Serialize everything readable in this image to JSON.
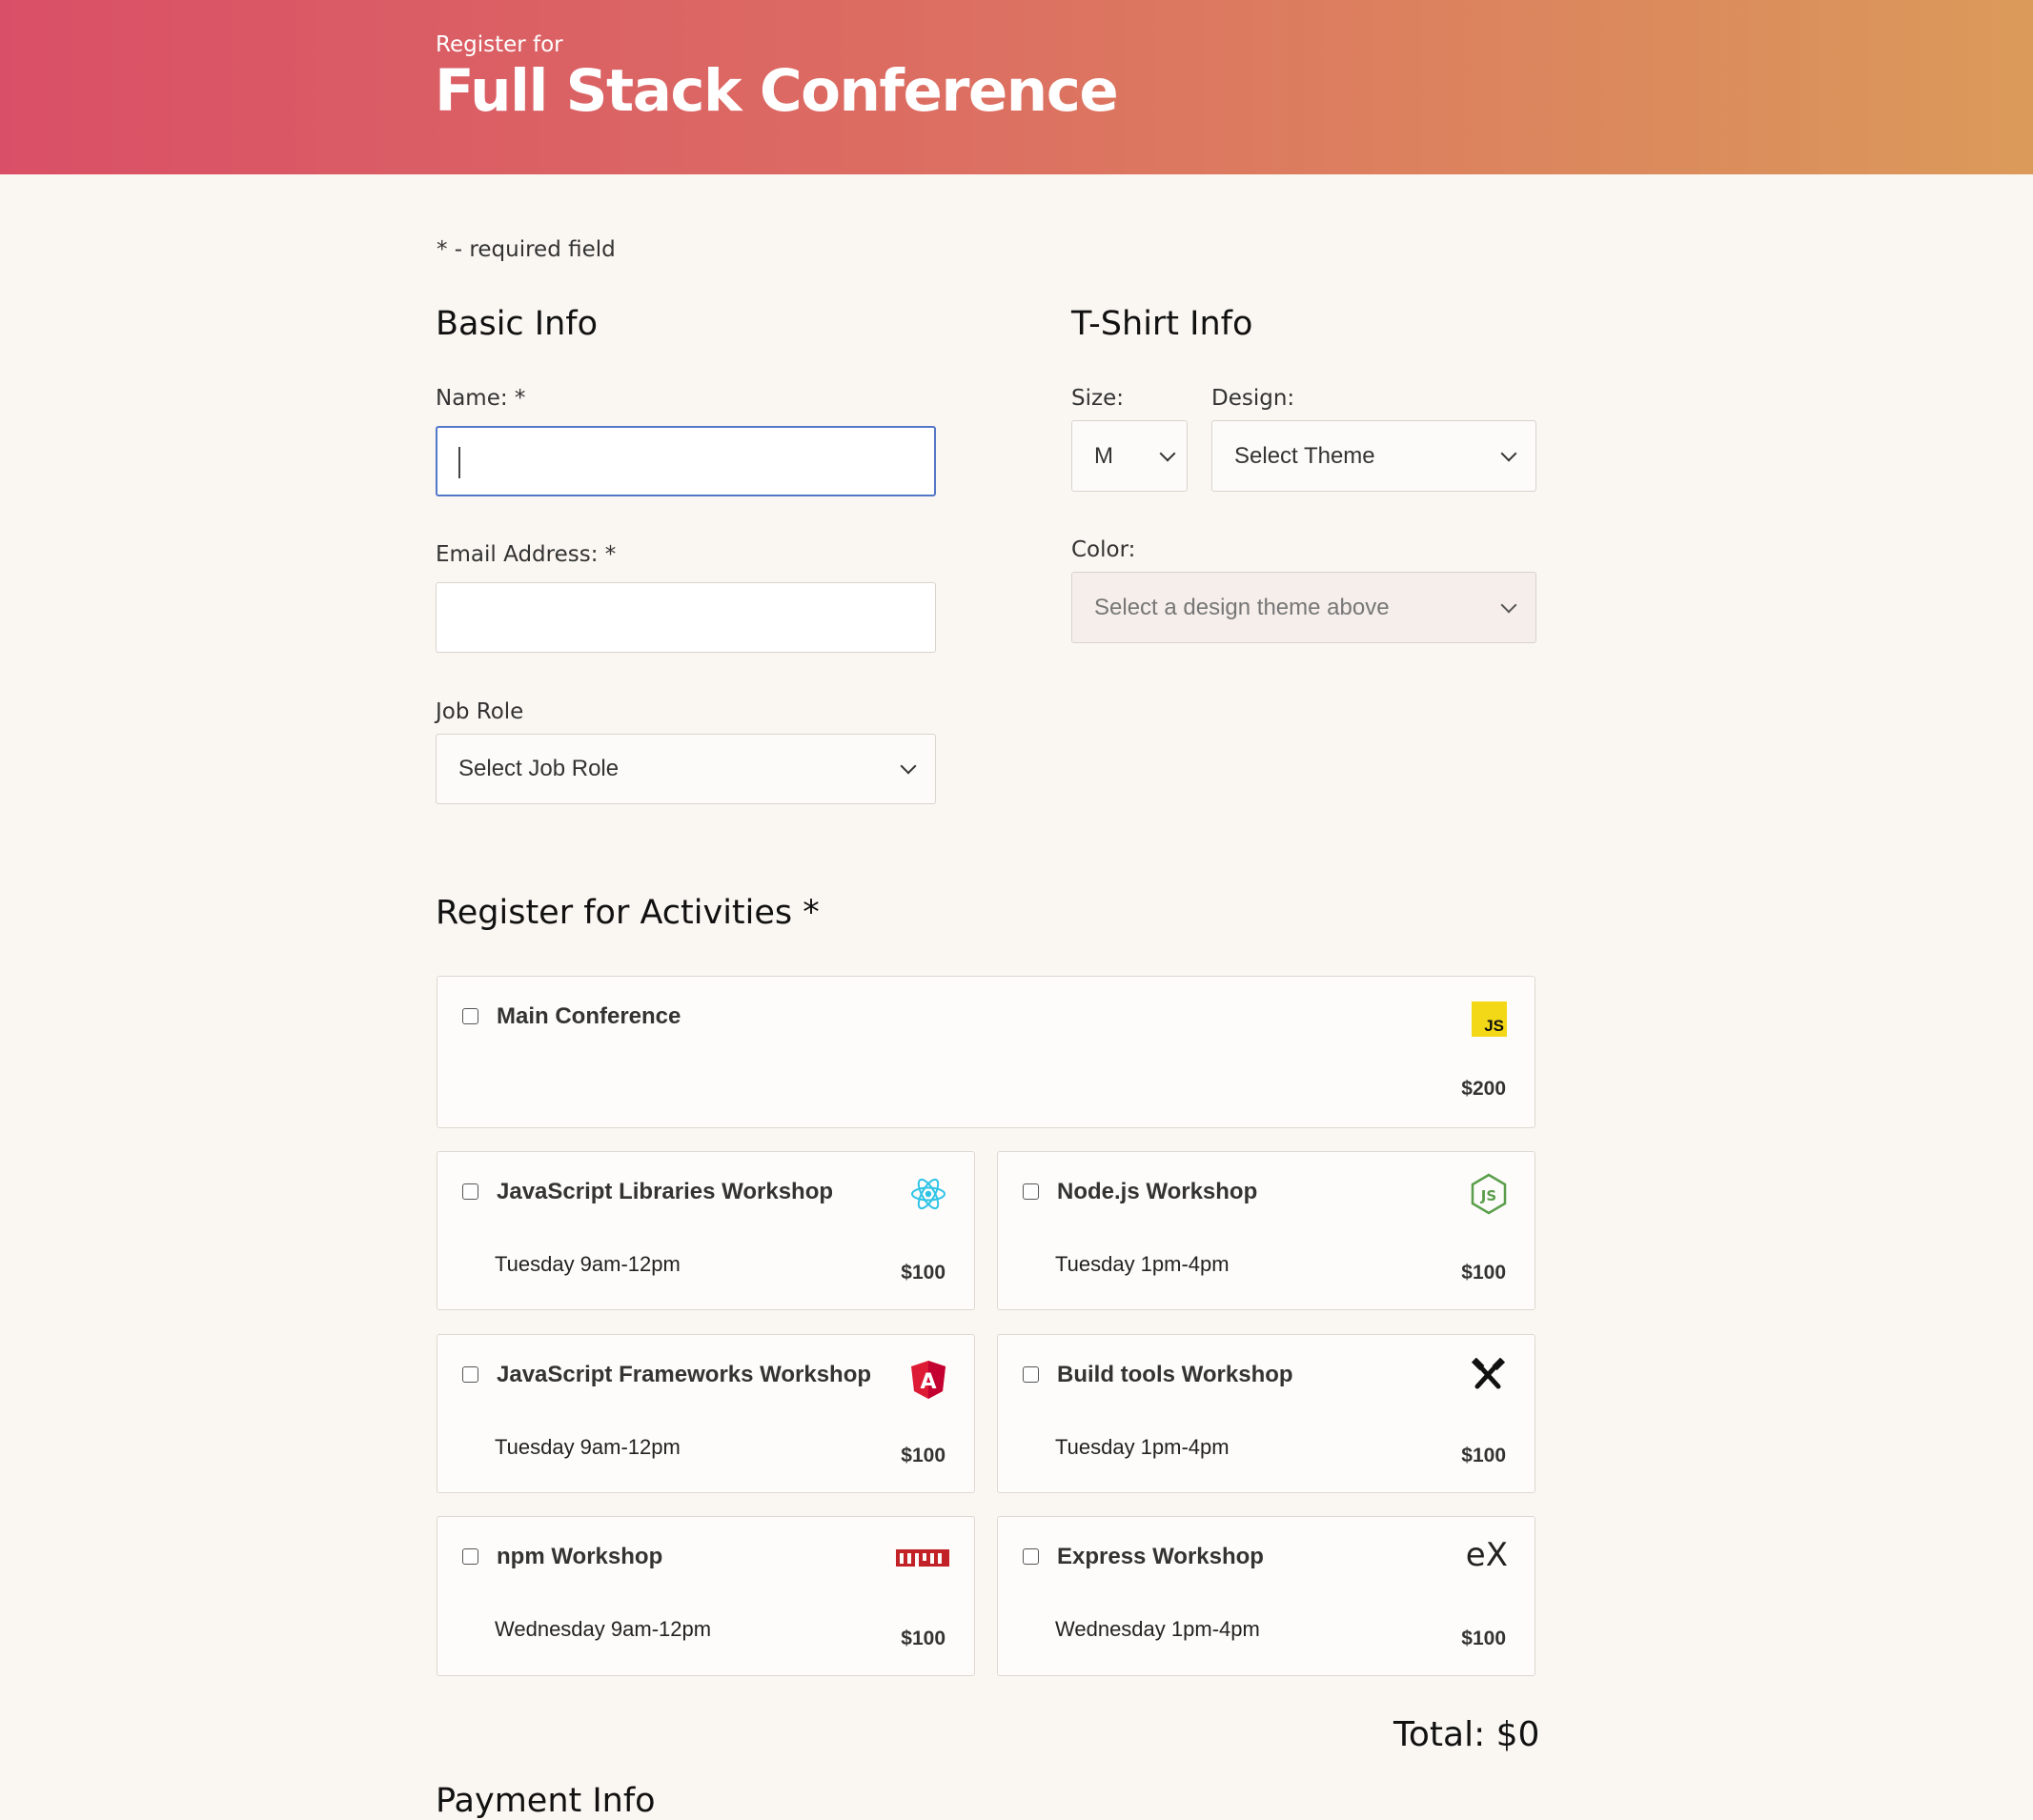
{
  "header": {
    "kicker": "Register for",
    "title": "Full Stack Conference"
  },
  "required_note": "* - required field",
  "basic_info": {
    "title": "Basic Info",
    "name_label": "Name: *",
    "name_value": "",
    "email_label": "Email Address: *",
    "email_value": "",
    "job_role_label": "Job Role",
    "job_role_selected": "Select Job Role"
  },
  "tshirt_info": {
    "title": "T-Shirt Info",
    "size_label": "Size:",
    "size_selected": "M",
    "design_label": "Design:",
    "design_selected": "Select Theme",
    "color_label": "Color:",
    "color_selected": "Select a design theme above"
  },
  "activities": {
    "title": "Register for Activities *",
    "items": [
      {
        "name": "Main Conference",
        "time": "",
        "price": "$200",
        "icon": "js-icon",
        "checked": false
      },
      {
        "name": "JavaScript Libraries Workshop",
        "time": "Tuesday 9am-12pm",
        "price": "$100",
        "icon": "react-icon",
        "checked": false
      },
      {
        "name": "Node.js Workshop",
        "time": "Tuesday 1pm-4pm",
        "price": "$100",
        "icon": "nodejs-icon",
        "checked": false
      },
      {
        "name": "JavaScript Frameworks Workshop",
        "time": "Tuesday 9am-12pm",
        "price": "$100",
        "icon": "angular-icon",
        "checked": false
      },
      {
        "name": "Build tools Workshop",
        "time": "Tuesday 1pm-4pm",
        "price": "$100",
        "icon": "tools-icon",
        "checked": false
      },
      {
        "name": "npm Workshop",
        "time": "Wednesday 9am-12pm",
        "price": "$100",
        "icon": "npm-icon",
        "checked": false
      },
      {
        "name": "Express Workshop",
        "time": "Wednesday 1pm-4pm",
        "price": "$100",
        "icon": "express-icon",
        "checked": false
      }
    ],
    "total": "Total: $0"
  },
  "payment_info": {
    "title": "Payment Info"
  },
  "colors": {
    "header_start": "#d94f67",
    "header_end": "#db9a5a",
    "page_bg": "#faf7f2",
    "focus_border": "#5477c7"
  }
}
